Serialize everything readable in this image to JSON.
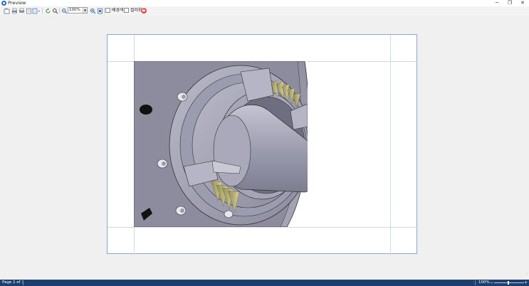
{
  "window": {
    "title": "Preview",
    "minimize": "─",
    "restore": "❐",
    "close": "✕"
  },
  "toolbar": {
    "zoom_value": "100%",
    "checkbox_1_label": "배경색",
    "checkbox_2_label": "컬러화"
  },
  "statusbar": {
    "page_info": "Page 1 of 1",
    "zoom_value": "100%",
    "zoom_minus": "−",
    "zoom_plus": "+"
  },
  "colors": {
    "statusbar_bg": "#1c3f6e",
    "page_border": "#8ea7c6",
    "stop_button": "#d11a1a",
    "model_body": "#8f8fa3",
    "fan_blades": "#c8c080"
  }
}
